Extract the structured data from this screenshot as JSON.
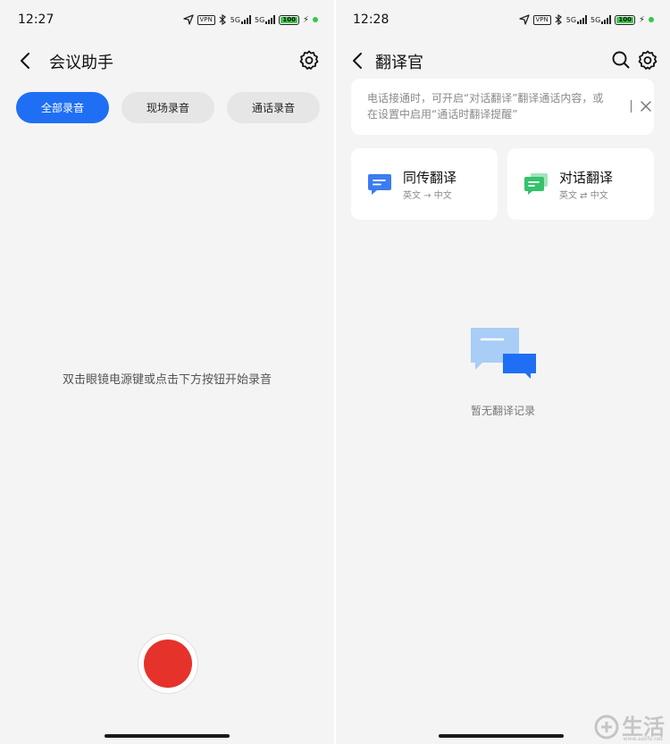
{
  "left_screen": {
    "status": {
      "time": "12:27",
      "vpn": "VPN",
      "net1": "5G",
      "net2": "5G",
      "battery": "100"
    },
    "nav": {
      "title": "会议助手",
      "back_icon": "back-chevron-icon",
      "settings_icon": "gear-icon"
    },
    "tabs": [
      {
        "label": "全部录音",
        "active": true
      },
      {
        "label": "现场录音",
        "active": false
      },
      {
        "label": "通话录音",
        "active": false
      }
    ],
    "hint": "双击眼镜电源键或点击下方按钮开始录音",
    "record_button": {
      "icon": "record-icon",
      "color": "#e5322b"
    }
  },
  "right_screen": {
    "status": {
      "time": "12:28",
      "vpn": "VPN",
      "net1": "5G",
      "net2": "5G",
      "battery": "100"
    },
    "nav": {
      "title": "翻译官",
      "search_icon": "search-icon",
      "settings_icon": "gear-icon"
    },
    "notice": {
      "text": "电话接通时，可开启“对话翻译”翻译通话内容，或在设置中启用“通话时翻译提醒”",
      "close_icon": "close-icon"
    },
    "cards": [
      {
        "title": "同传翻译",
        "subtitle": "英文 → 中文",
        "icon": "simultaneous-chat-icon",
        "color": "#3d7cf0"
      },
      {
        "title": "对话翻译",
        "subtitle": "英文 ⇄ 中文",
        "icon": "dialog-chat-icon",
        "color": "#34c36b"
      }
    ],
    "empty": {
      "icon": "empty-chat-icon",
      "text": "暂无翻译记录"
    }
  },
  "watermark": {
    "text": "生活",
    "url": "www.aalife.net"
  },
  "colors": {
    "accent": "#1f6ff5",
    "record": "#e5322b",
    "background": "#f4f4f4"
  }
}
